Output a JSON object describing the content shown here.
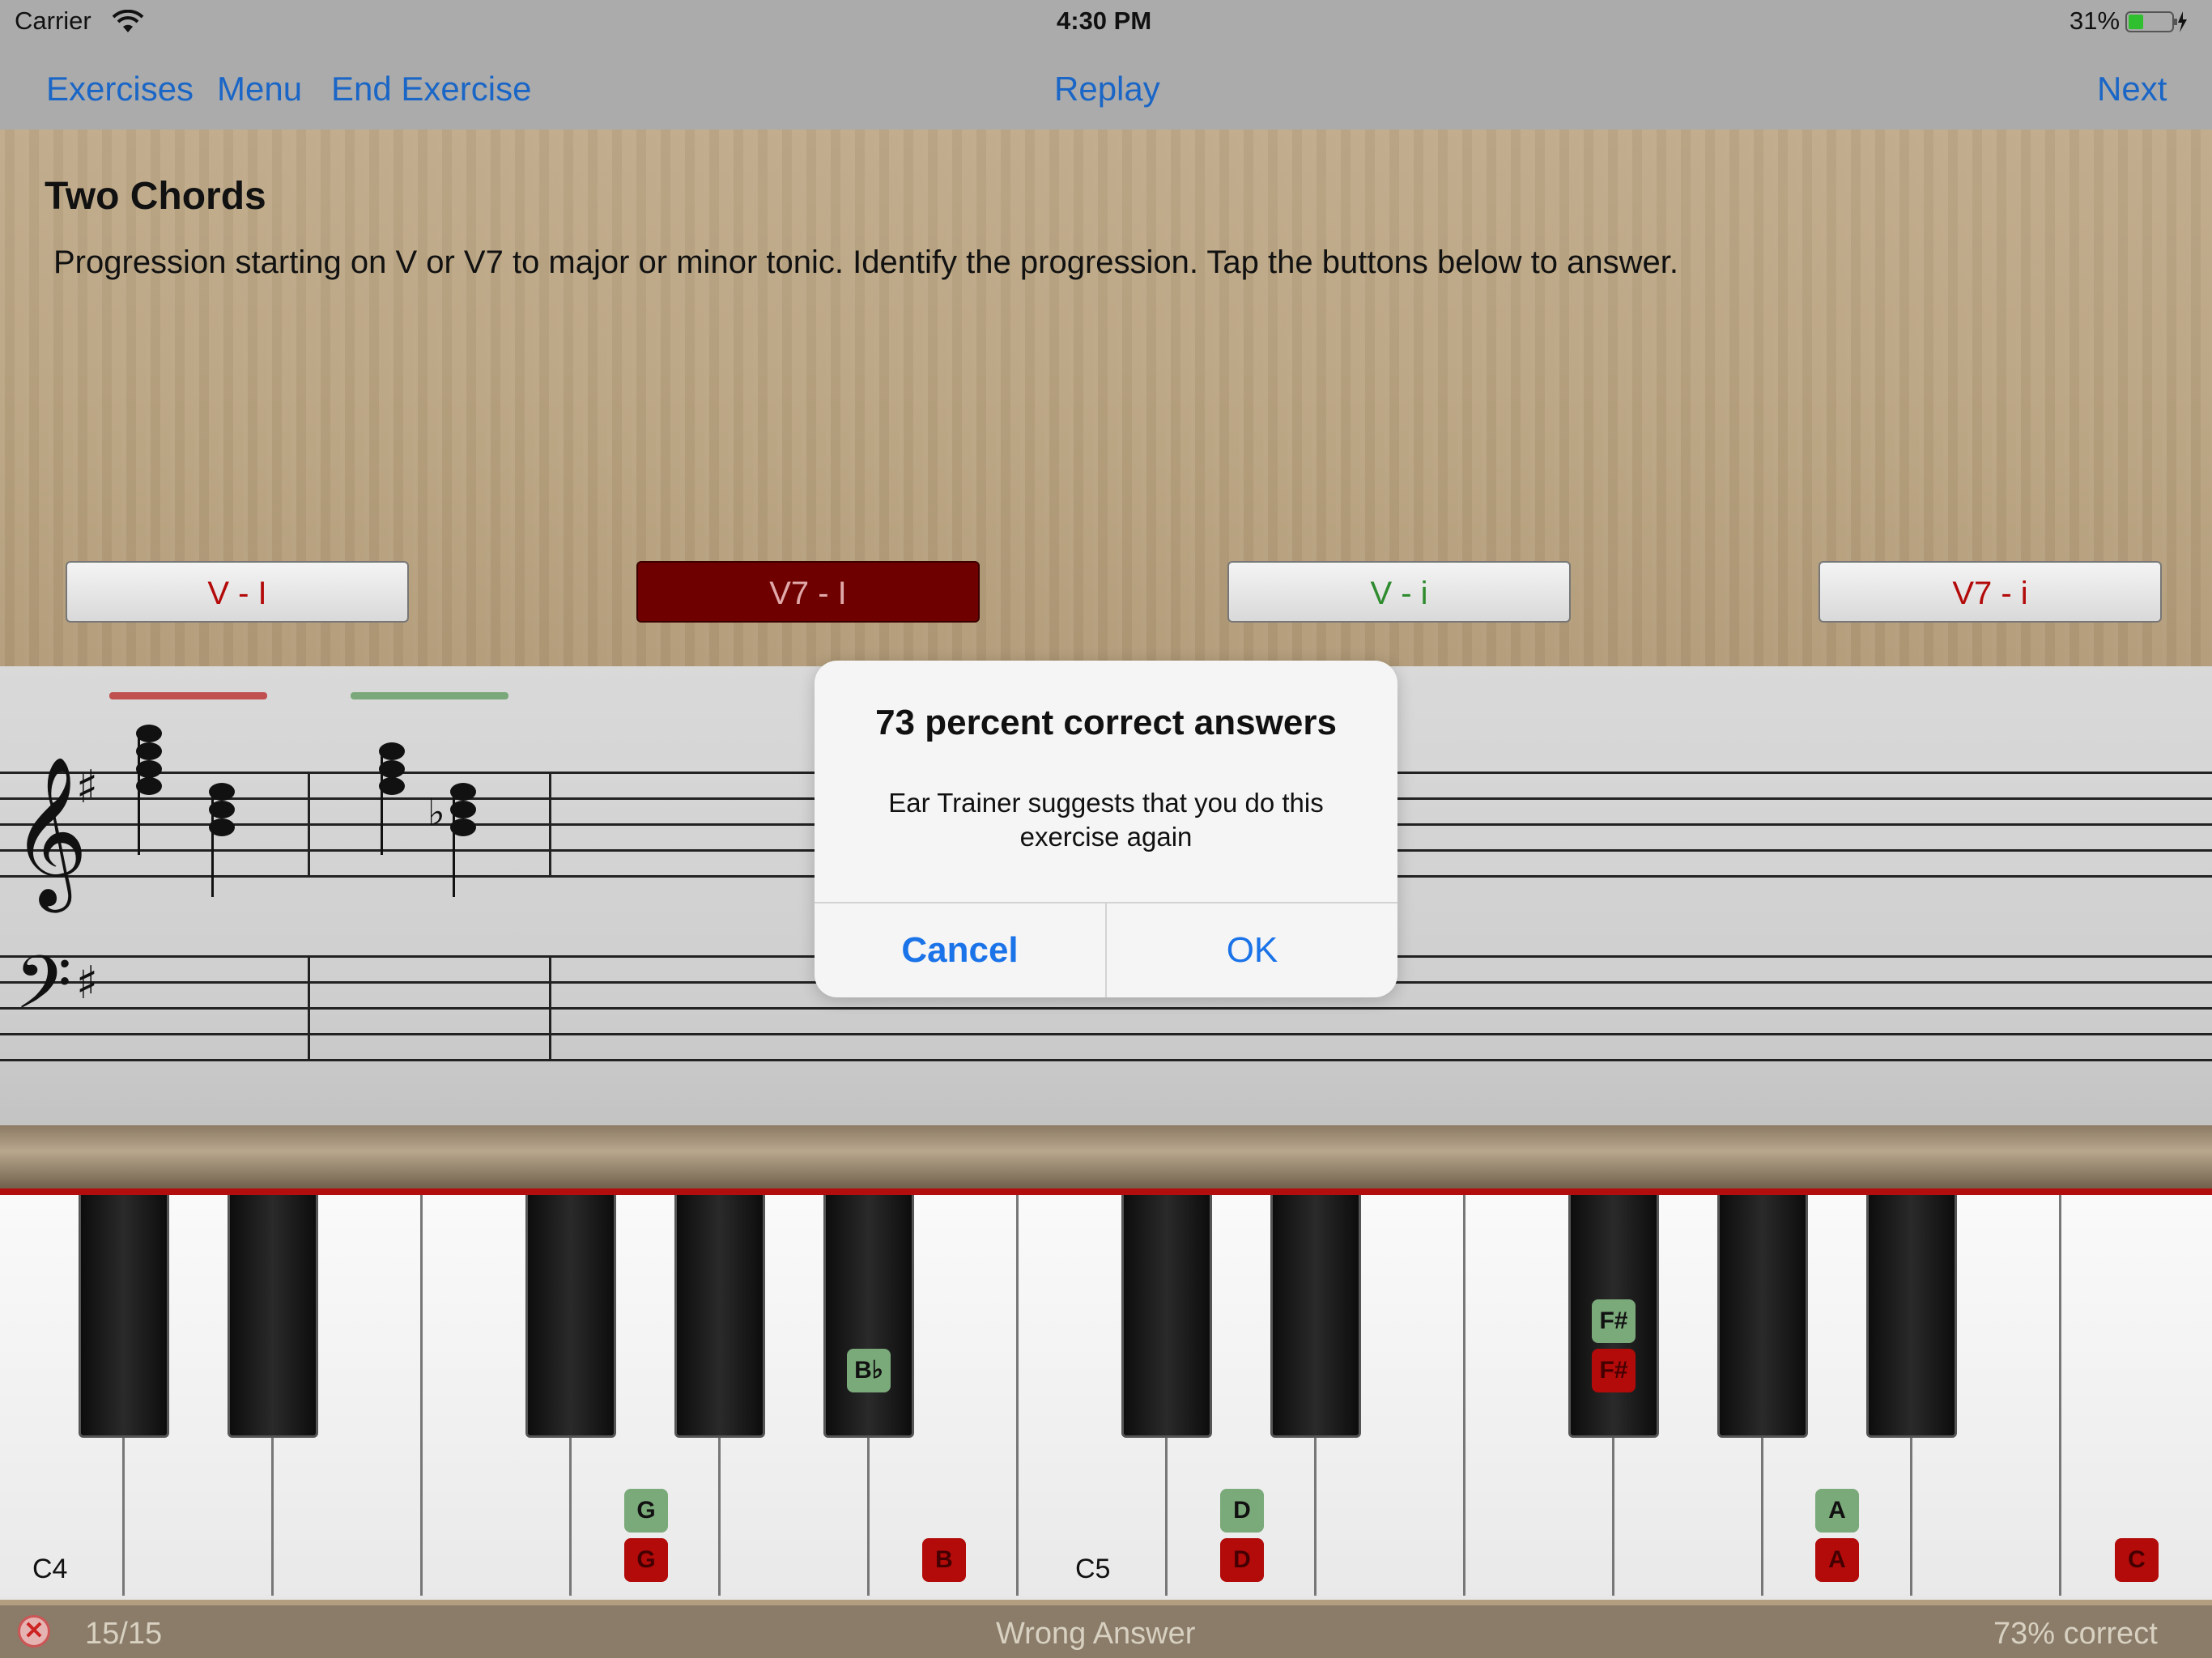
{
  "status_bar": {
    "carrier": "Carrier",
    "time": "4:30 PM",
    "battery": "31%"
  },
  "nav": {
    "exercises": "Exercises",
    "menu": "Menu",
    "end_exercise": "End Exercise",
    "replay": "Replay",
    "next": "Next"
  },
  "exercise": {
    "title": "Two Chords",
    "description": "Progression starting on V or V7 to major or minor tonic. Identify the progression. Tap the buttons below to answer."
  },
  "answers": [
    {
      "label": "V - I",
      "color": "#b30a0a",
      "selected": false
    },
    {
      "label": "V7 - I",
      "color": "#e0a8a8",
      "selected": true
    },
    {
      "label": "V - i",
      "color": "#2e8b2e",
      "selected": false
    },
    {
      "label": "V7 - i",
      "color": "#b30a0a",
      "selected": false
    }
  ],
  "keyboard": {
    "octave_labels": [
      "C4",
      "C5"
    ],
    "green_notes": [
      "G",
      "B♭",
      "D",
      "F#",
      "A"
    ],
    "red_notes": [
      "G",
      "B",
      "D",
      "F#",
      "A",
      "C"
    ]
  },
  "dialog": {
    "title": "73 percent correct answers",
    "message": "Ear Trainer suggests that you do this exercise again",
    "cancel": "Cancel",
    "ok": "OK"
  },
  "bottom_bar": {
    "progress": "15/15",
    "result": "Wrong Answer",
    "score": "73% correct"
  },
  "colors": {
    "accent": "#1a66c7",
    "correct": "#7aa97a",
    "wrong": "#b30a0a",
    "selected_answer": "#6f0000"
  }
}
